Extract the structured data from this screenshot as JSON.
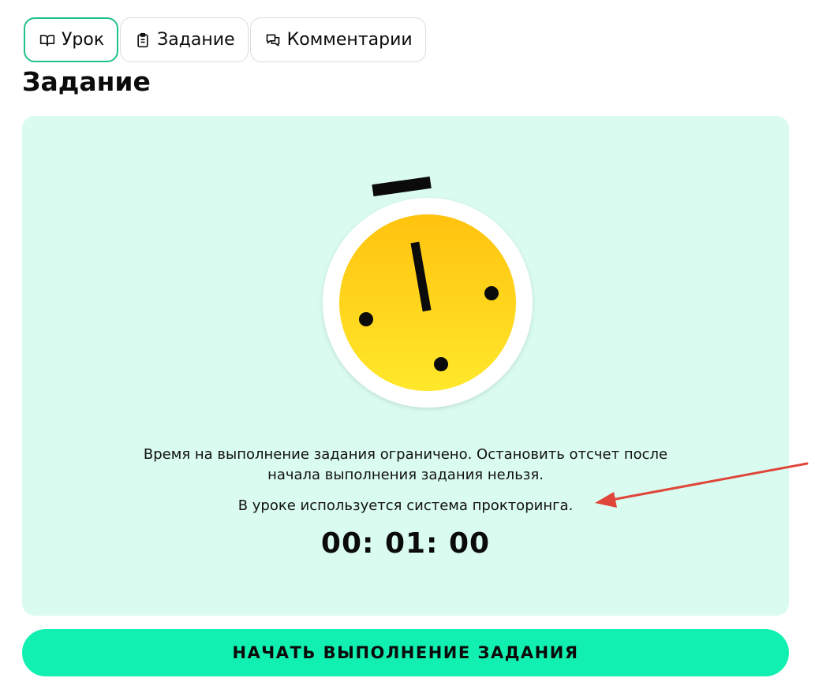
{
  "tabs": [
    {
      "label": "Урок",
      "icon": "book-open-icon",
      "active": true
    },
    {
      "label": "Задание",
      "icon": "clipboard-icon",
      "active": false
    },
    {
      "label": "Комментарии",
      "icon": "chat-bubbles-icon",
      "active": false
    }
  ],
  "page_title": "Задание",
  "notice": {
    "line1": "Время на выполнение задания ограничено. Остановить отсчет после",
    "line2": "начала выполнения задания нельзя.",
    "proctoring": "В уроке используется система прокторинга.",
    "timer": "00: 01: 00"
  },
  "start_button_label": "НАЧАТЬ ВЫПОЛНЕНИЕ ЗАДАНИЯ",
  "colors": {
    "accent": "#11f0b0",
    "active_tab_border": "#1fbf8f",
    "panel_bg": "#dafbf0",
    "stopwatch_top": "#ffc20f",
    "stopwatch_bottom": "#ffe82a",
    "annotation_arrow": "#e0453a"
  }
}
